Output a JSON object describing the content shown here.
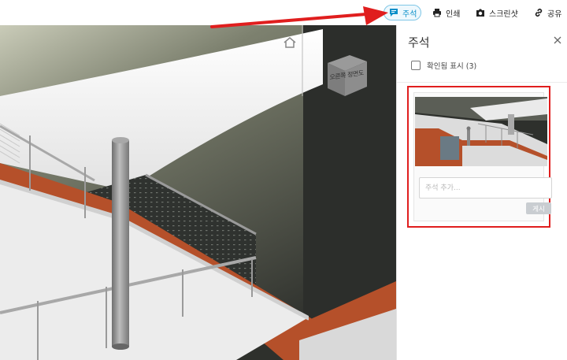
{
  "toolbar": {
    "comment_label": "주석",
    "print_label": "인쇄",
    "screenshot_label": "스크린샷",
    "share_label": "공유"
  },
  "viewport": {
    "viewcube_label": "오른쪽 정면도"
  },
  "panel": {
    "title": "주석",
    "show_resolved_label": "확인됨 표시 (3)",
    "show_resolved_checked": false,
    "comment_placeholder": "주석 추가...",
    "comment_value": "",
    "post_label": "게시"
  },
  "colors": {
    "accent": "#0a8fc9",
    "highlight": "#e01e1e",
    "slab": "#ececec",
    "terracotta": "#b5502a",
    "background": "#2e302c"
  }
}
